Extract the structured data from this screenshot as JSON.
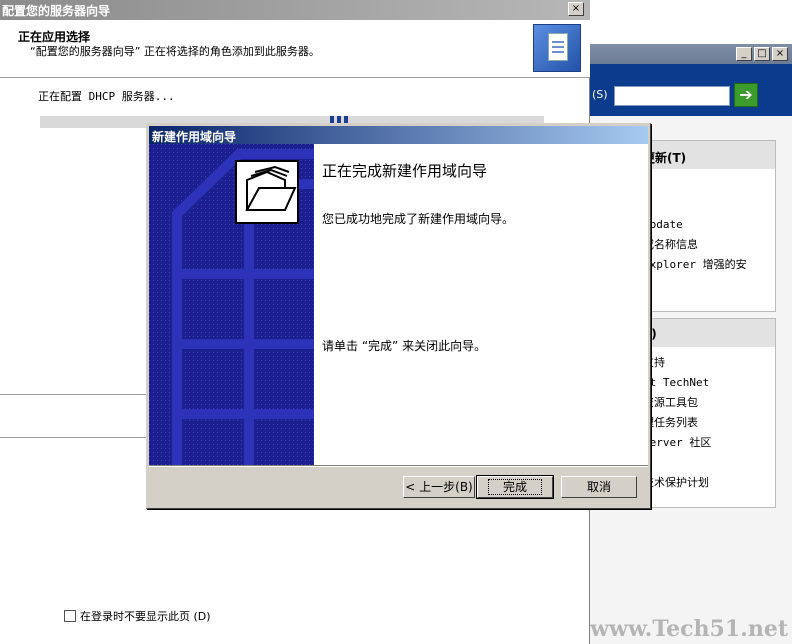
{
  "manage_server": {
    "search_label": "(S)",
    "search_placeholder": "",
    "go_icon": "arrow-right-icon",
    "window_controls": [
      "_",
      "□",
      "×"
    ],
    "panel_updates": {
      "title": "更新(T)",
      "items": [
        "",
        "",
        "Update",
        "或名称信息",
        "Explorer 增强的安"
      ]
    },
    "panel_support": {
      "title": "E)",
      "items": [
        "支持",
        "ft TechNet",
        "资源工具包",
        "理任务列表",
        "Server 社区",
        "",
        "技术保护计划"
      ]
    }
  },
  "configure_wizard": {
    "title": "配置您的服务器向导",
    "close": "×",
    "header_title": "正在应用选择",
    "header_subtitle": "“配置您的服务器向导” 正在将选择的角色添加到此服务器。",
    "status": "正在配置 DHCP 服务器...",
    "checkbox_label": "在登录时不要显示此页 (D)",
    "checkbox_checked": false
  },
  "scope_wizard": {
    "title": "新建作用域向导",
    "heading": "正在完成新建作用域向导",
    "paragraph1": "您已成功地完成了新建作用域向导。",
    "paragraph2": "请单击 “完成” 来关闭此向导。",
    "buttons": {
      "back": "< 上一步(B)",
      "finish": "完成",
      "cancel": "取消"
    },
    "icon": "folder-stack-icon"
  },
  "watermark": "www.Tech51.net"
}
